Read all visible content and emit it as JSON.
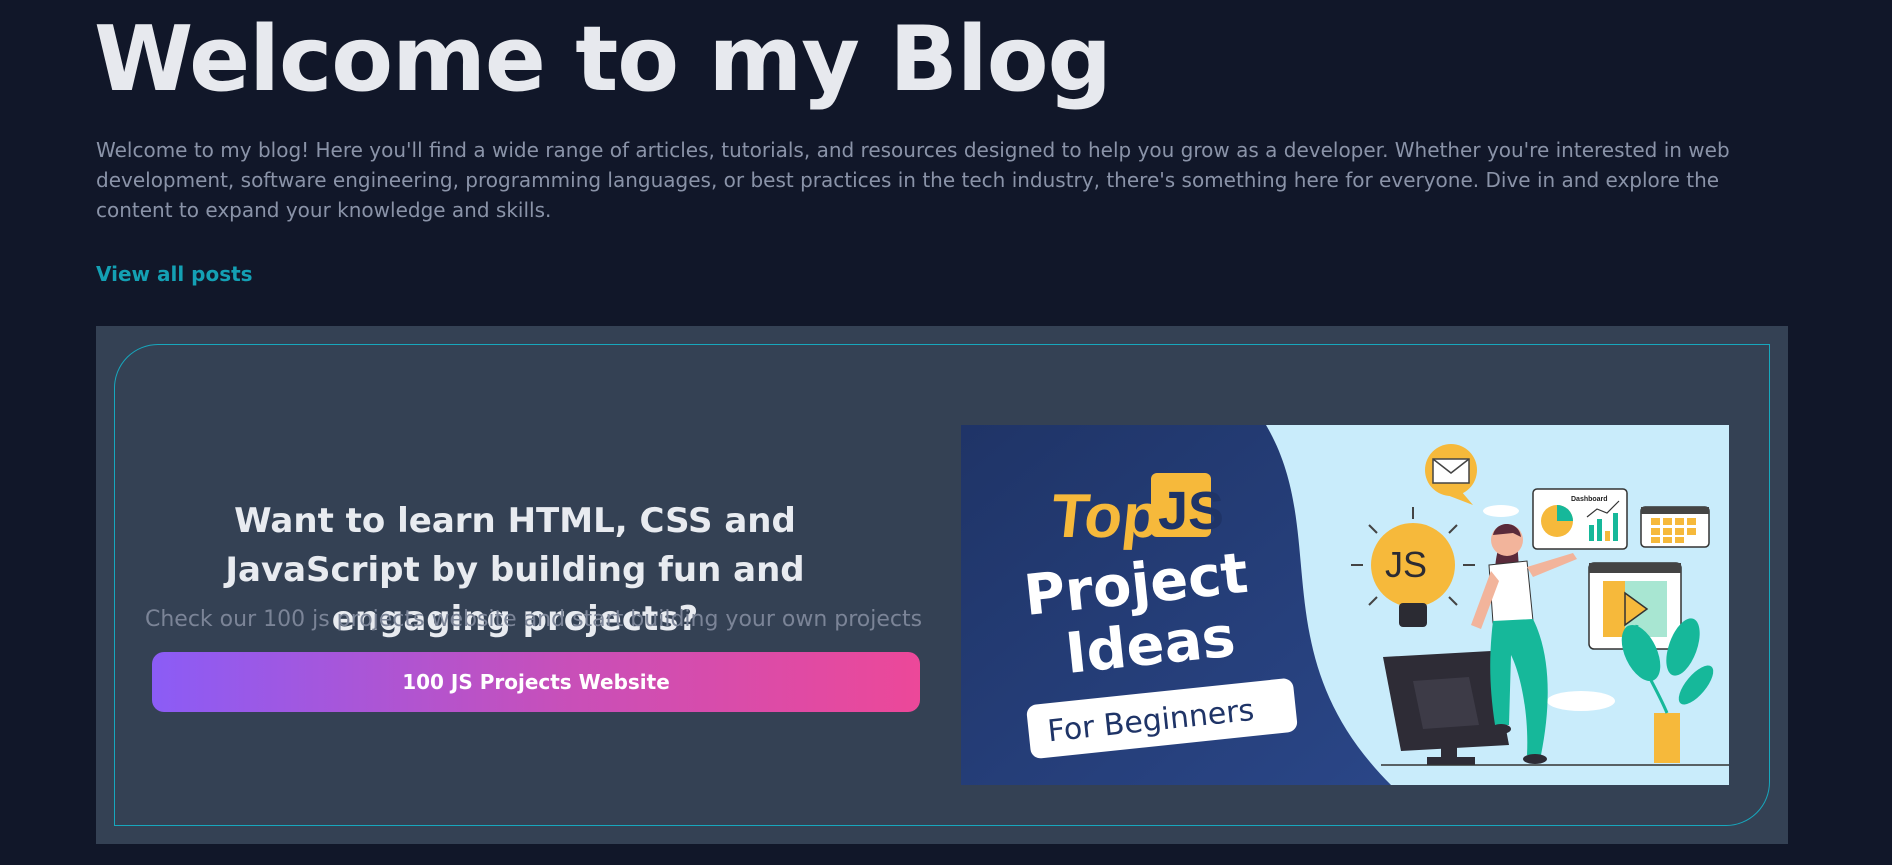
{
  "header": {
    "title": "Welcome to my Blog",
    "intro": "Welcome to my blog! Here you'll find a wide range of articles, tutorials, and resources designed to help you grow as a developer. Whether you're interested in web development, software engineering, programming languages, or best practices in the tech industry, there's something here for everyone. Dive in and explore the content to expand your knowledge and skills.",
    "view_all_label": "View all posts"
  },
  "banner": {
    "heading": "Want to learn HTML, CSS and JavaScript by building fun and engaging projects?",
    "subheading": "Check our 100 js projects website and start building your own projects",
    "button_label": "100 JS Projects Website",
    "image": {
      "top_word": "Top",
      "js_badge": "JS",
      "line1": "Project",
      "line2": "Ideas",
      "tag": "For Beginners",
      "bulb_text": "JS",
      "dashboard_label": "Dashboard"
    }
  },
  "colors": {
    "background": "#111729",
    "banner_bg": "#344154",
    "accent_link": "#14a0b4",
    "frame_border": "#17a7bd",
    "button_gradient_start": "#8b5cf6",
    "button_gradient_end": "#ec4899",
    "promo_navy": "#243a72",
    "promo_yellow": "#f6b93b"
  }
}
